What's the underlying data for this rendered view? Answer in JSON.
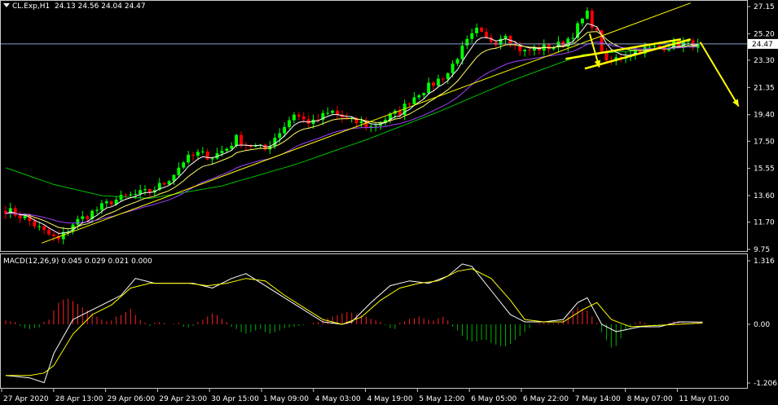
{
  "header": {
    "symbol": "CL.Exp,H1",
    "ohlc": "24.13 24.56 24.04 24.47"
  },
  "macd_header": {
    "label": "MACD(12,26,9) 0.045 0.029 0.021 0.000"
  },
  "colors": {
    "background": "#000000",
    "bull": "#00ff00",
    "bear": "#ff0000",
    "ma_fast": "#ffffff",
    "ma_mid": "#ffff66",
    "ma_purple": "#a040ff",
    "ma_slow": "#00c000",
    "trendline": "#ffff00",
    "macd_line": "#ffffff",
    "signal_line": "#ffff00",
    "hist_pos": "#ff2020",
    "hist_neg": "#00b000",
    "arrow": "#ffff00"
  },
  "chart_data": [
    {
      "type": "candlestick",
      "title": "CL.Exp,H1",
      "ylim": [
        9.75,
        27.15
      ],
      "yticks": [
        "27.15",
        "25.20",
        "23.30",
        "21.35",
        "19.40",
        "17.50",
        "15.55",
        "13.60",
        "11.70",
        "9.75"
      ],
      "current_price": "24.47",
      "x_tick_labels": [
        "27 Apr 2020",
        "28 Apr 13:00",
        "29 Apr 06:00",
        "29 Apr 23:00",
        "30 Apr 15:00",
        "1 May 09:00",
        "4 May 03:00",
        "4 May 19:00",
        "5 May 12:00",
        "6 May 05:00",
        "6 May 22:00",
        "7 May 14:00",
        "8 May 07:00",
        "11 May 01:00"
      ],
      "close_path": [
        [
          0,
          12.6
        ],
        [
          4,
          12.0
        ],
        [
          8,
          11.0
        ],
        [
          11,
          10.4
        ],
        [
          14,
          11.6
        ],
        [
          18,
          12.4
        ],
        [
          22,
          13.2
        ],
        [
          26,
          13.6
        ],
        [
          30,
          13.9
        ],
        [
          33,
          14.5
        ],
        [
          35,
          15.2
        ],
        [
          37,
          16.1
        ],
        [
          40,
          16.6
        ],
        [
          43,
          16.4
        ],
        [
          46,
          17.0
        ],
        [
          48,
          17.7
        ],
        [
          50,
          17.3
        ],
        [
          52,
          17.1
        ],
        [
          54,
          16.9
        ],
        [
          56,
          17.8
        ],
        [
          58,
          18.6
        ],
        [
          60,
          19.5
        ],
        [
          62,
          19.0
        ],
        [
          64,
          18.8
        ],
        [
          66,
          19.3
        ],
        [
          68,
          19.6
        ],
        [
          70,
          19.2
        ],
        [
          72,
          18.9
        ],
        [
          74,
          18.8
        ],
        [
          76,
          18.5
        ],
        [
          78,
          18.9
        ],
        [
          80,
          19.3
        ],
        [
          82,
          19.6
        ],
        [
          84,
          20.4
        ],
        [
          86,
          21.0
        ],
        [
          88,
          21.4
        ],
        [
          90,
          21.9
        ],
        [
          92,
          22.4
        ],
        [
          94,
          23.6
        ],
        [
          96,
          24.6
        ],
        [
          98,
          25.4
        ],
        [
          100,
          24.8
        ],
        [
          102,
          24.7
        ],
        [
          104,
          25.3
        ],
        [
          106,
          24.3
        ],
        [
          108,
          23.9
        ],
        [
          110,
          24.1
        ],
        [
          112,
          24.2
        ],
        [
          114,
          24.3
        ],
        [
          116,
          24.5
        ],
        [
          118,
          25.2
        ],
        [
          120,
          26.2
        ],
        [
          121,
          26.6
        ],
        [
          123,
          25.2
        ],
        [
          125,
          23.0
        ],
        [
          127,
          23.4
        ],
        [
          129,
          23.7
        ],
        [
          131,
          24.0
        ],
        [
          133,
          24.1
        ],
        [
          135,
          24.2
        ],
        [
          137,
          24.3
        ],
        [
          139,
          24.4
        ],
        [
          141,
          24.5
        ],
        [
          143,
          24.47
        ]
      ],
      "moving_averages": [
        {
          "name": "ma_fast",
          "lag": 2,
          "color": "#ffffff"
        },
        {
          "name": "ma_mid",
          "lag": 5,
          "color": "#ffff66"
        },
        {
          "name": "ma_purple",
          "lag": 12,
          "color": "#a040ff"
        }
      ],
      "slow_ma_path": [
        [
          0,
          15.6
        ],
        [
          10,
          14.4
        ],
        [
          20,
          13.6
        ],
        [
          30,
          13.4
        ],
        [
          45,
          14.3
        ],
        [
          60,
          15.8
        ],
        [
          75,
          17.6
        ],
        [
          90,
          19.6
        ],
        [
          105,
          21.8
        ],
        [
          120,
          23.7
        ],
        [
          143,
          24.3
        ]
      ],
      "trendline": {
        "from": [
          8,
          10.2
        ],
        "to": [
          143,
          27.4
        ]
      },
      "wedge_upper": {
        "from": [
          117,
          23.4
        ],
        "to": [
          141,
          24.8
        ]
      },
      "wedge_lower": {
        "from": [
          121,
          22.7
        ],
        "to": [
          143,
          24.8
        ]
      },
      "forecast_arrow": {
        "from": [
          145,
          24.6
        ],
        "to": [
          153,
          20.0
        ]
      },
      "swing_arrow": {
        "from": [
          122,
          25.2
        ],
        "to": [
          124,
          22.8
        ]
      }
    },
    {
      "type": "line",
      "title": "MACD(12,26,9) 0.045 0.029 0.021 0.000",
      "ylim": [
        -1.206,
        1.316
      ],
      "yticks": [
        "1.316",
        "0.00",
        "-1.206"
      ],
      "series": [
        {
          "name": "MACD",
          "points": [
            [
              0,
              -1.05
            ],
            [
              5,
              -1.1
            ],
            [
              8,
              -1.2
            ],
            [
              10,
              -0.6
            ],
            [
              14,
              0.1
            ],
            [
              18,
              0.3
            ],
            [
              20,
              0.4
            ],
            [
              24,
              0.6
            ],
            [
              27,
              0.95
            ],
            [
              31,
              0.85
            ],
            [
              35,
              0.85
            ],
            [
              39,
              0.85
            ],
            [
              43,
              0.75
            ],
            [
              47,
              0.95
            ],
            [
              50,
              1.05
            ],
            [
              54,
              0.8
            ],
            [
              58,
              0.55
            ],
            [
              62,
              0.3
            ],
            [
              66,
              0.05
            ],
            [
              70,
              0.0
            ],
            [
              72,
              0.05
            ],
            [
              76,
              0.45
            ],
            [
              80,
              0.8
            ],
            [
              84,
              0.9
            ],
            [
              88,
              0.85
            ],
            [
              92,
              1.0
            ],
            [
              95,
              1.25
            ],
            [
              97,
              1.2
            ],
            [
              101,
              0.7
            ],
            [
              105,
              0.2
            ],
            [
              108,
              0.05
            ],
            [
              112,
              0.05
            ],
            [
              116,
              0.1
            ],
            [
              119,
              0.45
            ],
            [
              121,
              0.55
            ],
            [
              124,
              0.0
            ],
            [
              127,
              -0.15
            ],
            [
              132,
              -0.05
            ],
            [
              136,
              -0.05
            ],
            [
              140,
              0.05
            ],
            [
              145,
              0.045
            ]
          ]
        },
        {
          "name": "Signal",
          "points": [
            [
              0,
              -1.05
            ],
            [
              5,
              -1.05
            ],
            [
              8,
              -1.0
            ],
            [
              10,
              -0.85
            ],
            [
              14,
              -0.2
            ],
            [
              18,
              0.2
            ],
            [
              22,
              0.4
            ],
            [
              26,
              0.75
            ],
            [
              30,
              0.85
            ],
            [
              34,
              0.85
            ],
            [
              38,
              0.85
            ],
            [
              42,
              0.8
            ],
            [
              46,
              0.85
            ],
            [
              50,
              0.95
            ],
            [
              54,
              0.9
            ],
            [
              58,
              0.6
            ],
            [
              62,
              0.35
            ],
            [
              66,
              0.1
            ],
            [
              70,
              0.0
            ],
            [
              74,
              0.15
            ],
            [
              78,
              0.5
            ],
            [
              82,
              0.75
            ],
            [
              86,
              0.85
            ],
            [
              90,
              0.9
            ],
            [
              94,
              1.1
            ],
            [
              97,
              1.15
            ],
            [
              101,
              0.95
            ],
            [
              105,
              0.5
            ],
            [
              108,
              0.1
            ],
            [
              112,
              0.05
            ],
            [
              116,
              0.05
            ],
            [
              120,
              0.3
            ],
            [
              123,
              0.45
            ],
            [
              126,
              0.1
            ],
            [
              130,
              -0.05
            ],
            [
              134,
              -0.03
            ],
            [
              140,
              0.0
            ],
            [
              145,
              0.029
            ]
          ]
        }
      ],
      "histogram": [
        [
          0,
          0.05
        ],
        [
          1,
          0.04
        ],
        [
          2,
          0.03
        ],
        [
          3,
          -0.02
        ],
        [
          4,
          -0.05
        ],
        [
          5,
          -0.06
        ],
        [
          6,
          -0.05
        ],
        [
          7,
          -0.04
        ],
        [
          8,
          0.03
        ],
        [
          9,
          0.06
        ],
        [
          10,
          0.18
        ],
        [
          11,
          0.28
        ],
        [
          12,
          0.32
        ],
        [
          13,
          0.33
        ],
        [
          14,
          0.3
        ],
        [
          15,
          0.26
        ],
        [
          16,
          0.22
        ],
        [
          17,
          0.18
        ],
        [
          18,
          0.14
        ],
        [
          19,
          0.1
        ],
        [
          20,
          0.06
        ],
        [
          21,
          0.04
        ],
        [
          22,
          0.05
        ],
        [
          23,
          0.1
        ],
        [
          24,
          0.12
        ],
        [
          25,
          0.16
        ],
        [
          26,
          0.2
        ],
        [
          27,
          0.12
        ],
        [
          28,
          0.06
        ],
        [
          29,
          0.02
        ],
        [
          30,
          -0.02
        ],
        [
          31,
          0.02
        ],
        [
          32,
          0.03
        ],
        [
          33,
          0.02
        ],
        [
          34,
          0.0
        ],
        [
          35,
          0.01
        ],
        [
          36,
          0.02
        ],
        [
          37,
          -0.03
        ],
        [
          38,
          -0.04
        ],
        [
          39,
          -0.02
        ],
        [
          40,
          0.03
        ],
        [
          41,
          0.06
        ],
        [
          42,
          0.1
        ],
        [
          43,
          0.14
        ],
        [
          44,
          0.12
        ],
        [
          45,
          0.07
        ],
        [
          46,
          0.03
        ],
        [
          47,
          -0.03
        ],
        [
          48,
          -0.06
        ],
        [
          49,
          -0.1
        ],
        [
          50,
          -0.12
        ],
        [
          51,
          -0.1
        ],
        [
          52,
          -0.08
        ],
        [
          53,
          -0.06
        ],
        [
          54,
          -0.1
        ],
        [
          55,
          -0.12
        ],
        [
          56,
          -0.1
        ],
        [
          57,
          -0.08
        ],
        [
          58,
          -0.05
        ],
        [
          59,
          -0.04
        ],
        [
          60,
          -0.03
        ],
        [
          61,
          -0.02
        ],
        [
          62,
          -0.01
        ],
        [
          63,
          0.0
        ],
        [
          64,
          0.02
        ],
        [
          65,
          0.03
        ],
        [
          66,
          0.05
        ],
        [
          67,
          0.08
        ],
        [
          68,
          0.1
        ],
        [
          69,
          0.12
        ],
        [
          70,
          0.14
        ],
        [
          71,
          0.16
        ],
        [
          72,
          0.15
        ],
        [
          73,
          0.13
        ],
        [
          74,
          0.12
        ],
        [
          75,
          0.1
        ],
        [
          76,
          0.07
        ],
        [
          77,
          0.05
        ],
        [
          78,
          0.03
        ],
        [
          79,
          -0.01
        ],
        [
          80,
          -0.05
        ],
        [
          81,
          -0.06
        ],
        [
          82,
          0.02
        ],
        [
          83,
          0.04
        ],
        [
          84,
          0.07
        ],
        [
          85,
          0.08
        ],
        [
          86,
          0.1
        ],
        [
          87,
          0.08
        ],
        [
          88,
          0.06
        ],
        [
          89,
          0.05
        ],
        [
          90,
          0.08
        ],
        [
          91,
          0.1
        ],
        [
          92,
          0.05
        ],
        [
          93,
          -0.03
        ],
        [
          94,
          -0.08
        ],
        [
          95,
          -0.15
        ],
        [
          96,
          -0.2
        ],
        [
          97,
          -0.22
        ],
        [
          98,
          -0.22
        ],
        [
          99,
          -0.2
        ],
        [
          100,
          -0.2
        ],
        [
          101,
          -0.24
        ],
        [
          102,
          -0.26
        ],
        [
          103,
          -0.28
        ],
        [
          104,
          -0.28
        ],
        [
          105,
          -0.25
        ],
        [
          106,
          -0.2
        ],
        [
          107,
          -0.15
        ],
        [
          108,
          -0.1
        ],
        [
          109,
          -0.05
        ],
        [
          110,
          0.0
        ],
        [
          111,
          0.02
        ],
        [
          112,
          0.03
        ],
        [
          113,
          0.02
        ],
        [
          114,
          0.01
        ],
        [
          115,
          0.02
        ],
        [
          116,
          0.05
        ],
        [
          117,
          0.1
        ],
        [
          118,
          0.18
        ],
        [
          119,
          0.22
        ],
        [
          120,
          0.2
        ],
        [
          121,
          0.18
        ],
        [
          122,
          0.1
        ],
        [
          123,
          0.02
        ],
        [
          124,
          -0.1
        ],
        [
          125,
          -0.2
        ],
        [
          126,
          -0.3
        ],
        [
          127,
          -0.28
        ],
        [
          128,
          -0.18
        ],
        [
          129,
          -0.08
        ],
        [
          130,
          -0.03
        ],
        [
          131,
          0.02
        ],
        [
          132,
          0.04
        ],
        [
          133,
          0.02
        ],
        [
          134,
          0.0
        ],
        [
          135,
          -0.02
        ],
        [
          136,
          -0.03
        ],
        [
          137,
          -0.02
        ],
        [
          138,
          0.02
        ],
        [
          139,
          0.04
        ],
        [
          140,
          0.03
        ],
        [
          141,
          0.02
        ],
        [
          142,
          0.0
        ],
        [
          143,
          0.02
        ],
        [
          144,
          0.021
        ]
      ]
    }
  ]
}
